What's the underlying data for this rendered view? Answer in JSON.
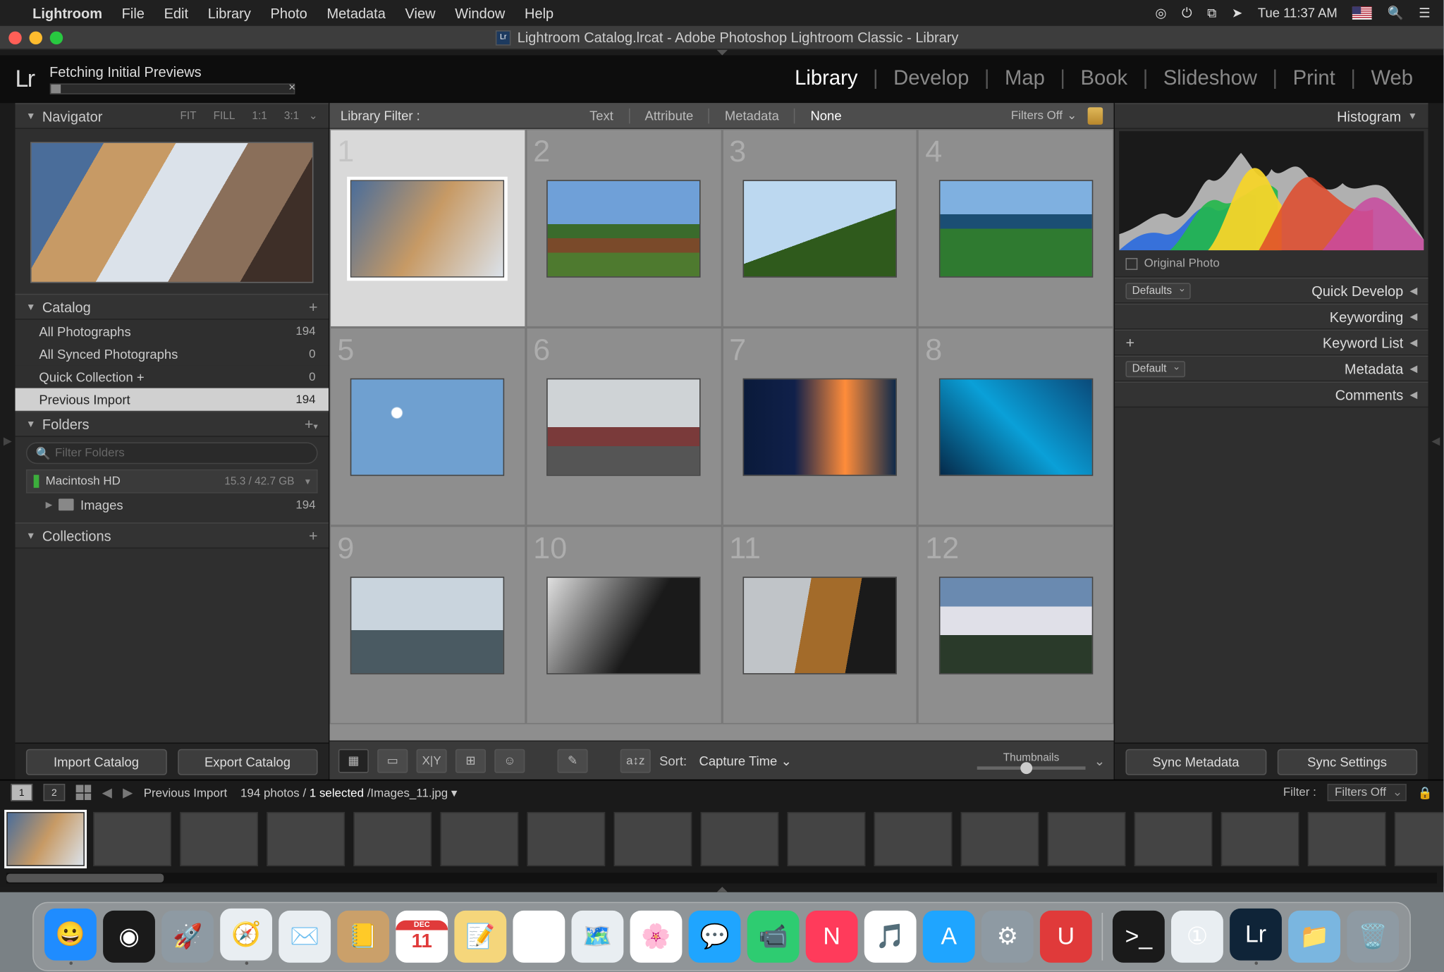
{
  "menubar": {
    "app": "Lightroom",
    "items": [
      "File",
      "Edit",
      "Library",
      "Photo",
      "Metadata",
      "View",
      "Window",
      "Help"
    ],
    "clock": "Tue 11:37 AM"
  },
  "window_title": "Lightroom Catalog.lrcat - Adobe Photoshop Lightroom Classic - Library",
  "idbar": {
    "logo": "Lr",
    "status": "Fetching Initial Previews"
  },
  "modules": [
    "Library",
    "Develop",
    "Map",
    "Book",
    "Slideshow",
    "Print",
    "Web"
  ],
  "active_module": "Library",
  "left": {
    "navigator": {
      "title": "Navigator",
      "opts": [
        "FIT",
        "FILL",
        "1:1",
        "3:1"
      ]
    },
    "catalog": {
      "title": "Catalog",
      "rows": [
        {
          "label": "All Photographs",
          "count": "194"
        },
        {
          "label": "All Synced Photographs",
          "count": "0"
        },
        {
          "label": "Quick Collection  +",
          "count": "0"
        },
        {
          "label": "Previous Import",
          "count": "194",
          "selected": true
        }
      ]
    },
    "folders": {
      "title": "Folders",
      "placeholder": "Filter Folders",
      "volume": {
        "name": "Macintosh HD",
        "space": "15.3 / 42.7 GB"
      },
      "sub": {
        "name": "Images",
        "count": "194"
      }
    },
    "collections": {
      "title": "Collections"
    },
    "buttons": {
      "import": "Import Catalog",
      "export": "Export Catalog"
    }
  },
  "filterbar": {
    "label": "Library Filter :",
    "tabs": [
      "Text",
      "Attribute",
      "Metadata",
      "None"
    ],
    "active": "None",
    "filters_label": "Filters Off"
  },
  "grid_count": 12,
  "gridbar": {
    "sort_label": "Sort:",
    "sort_value": "Capture Time",
    "thumb_label": "Thumbnails"
  },
  "right": {
    "histogram": "Histogram",
    "orig": "Original Photo",
    "sections": [
      {
        "dd": "Defaults",
        "title": "Quick Develop"
      },
      {
        "title": "Keywording"
      },
      {
        "plus": true,
        "title": "Keyword List"
      },
      {
        "dd": "Default",
        "title": "Metadata"
      },
      {
        "title": "Comments"
      }
    ],
    "buttons": {
      "sync_meta": "Sync Metadata",
      "sync_set": "Sync Settings"
    }
  },
  "filmstrip": {
    "source": "Previous Import",
    "count": "194 photos",
    "selected": "1 selected",
    "file": "Images_11.jpg",
    "filter_label": "Filter :",
    "filter_value": "Filters Off"
  },
  "dock": [
    {
      "n": "finder",
      "bg": "#1f8cff",
      "g": "😀"
    },
    {
      "n": "siri",
      "bg": "#1a1a1a",
      "g": "◉"
    },
    {
      "n": "launchpad",
      "bg": "#8e9aa3",
      "g": "🚀"
    },
    {
      "n": "safari",
      "bg": "#e9eef2",
      "g": "🧭"
    },
    {
      "n": "mail",
      "bg": "#e9eef2",
      "g": "✉️"
    },
    {
      "n": "contacts",
      "bg": "#caa06a",
      "g": "📒"
    },
    {
      "n": "calendar",
      "bg": "#fff",
      "g": "11"
    },
    {
      "n": "notes",
      "bg": "#f5d67b",
      "g": "📝"
    },
    {
      "n": "reminders",
      "bg": "#fff",
      "g": "☑︎"
    },
    {
      "n": "maps",
      "bg": "#e9eef2",
      "g": "🗺️"
    },
    {
      "n": "photos",
      "bg": "#fff",
      "g": "🌸"
    },
    {
      "n": "messages",
      "bg": "#1fa5ff",
      "g": "💬"
    },
    {
      "n": "facetime",
      "bg": "#2ecc71",
      "g": "📹"
    },
    {
      "n": "news",
      "bg": "#ff3b5b",
      "g": "N"
    },
    {
      "n": "itunes",
      "bg": "#fff",
      "g": "🎵"
    },
    {
      "n": "appstore",
      "bg": "#1fa5ff",
      "g": "A"
    },
    {
      "n": "settings",
      "bg": "#8e9aa3",
      "g": "⚙︎"
    },
    {
      "n": "magnet",
      "bg": "#e03a3a",
      "g": "U"
    },
    {
      "n": "sep"
    },
    {
      "n": "terminal",
      "bg": "#1a1a1a",
      "g": ">_"
    },
    {
      "n": "1password",
      "bg": "#e9eef2",
      "g": "①"
    },
    {
      "n": "lightroom",
      "bg": "#0f2438",
      "g": "Lr"
    },
    {
      "n": "downloads",
      "bg": "#7ab6e0",
      "g": "📁"
    },
    {
      "n": "trash",
      "bg": "#8e9aa3",
      "g": "🗑️"
    }
  ]
}
